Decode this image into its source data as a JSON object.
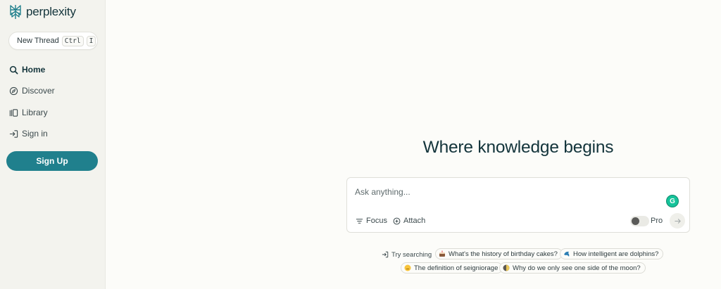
{
  "brand": {
    "name": "perplexity",
    "accent": "#20808d"
  },
  "sidebar": {
    "new_thread": {
      "label": "New Thread",
      "shortcut_1": "Ctrl",
      "shortcut_2": "I"
    },
    "items": [
      {
        "label": "Home",
        "icon": "search-icon",
        "active": true
      },
      {
        "label": "Discover",
        "icon": "compass-icon",
        "active": false
      },
      {
        "label": "Library",
        "icon": "library-icon",
        "active": false
      },
      {
        "label": "Sign in",
        "icon": "sign-in-icon",
        "active": false
      }
    ],
    "signup_label": "Sign Up"
  },
  "main": {
    "headline": "Where knowledge begins",
    "ask": {
      "placeholder": "Ask anything...",
      "focus_label": "Focus",
      "attach_label": "Attach",
      "pro_label": "Pro",
      "pro_enabled": false
    },
    "suggestions": {
      "label": "Try searching",
      "items": [
        {
          "text": "What's the history of birthday cakes?",
          "icon": "cake-emoji"
        },
        {
          "text": "How intelligent are dolphins?",
          "icon": "dolphin-emoji"
        },
        {
          "text": "The definition of seigniorage",
          "icon": "face-emoji"
        },
        {
          "text": "Why do we only see one side of the moon?",
          "icon": "moon-emoji"
        }
      ]
    }
  }
}
